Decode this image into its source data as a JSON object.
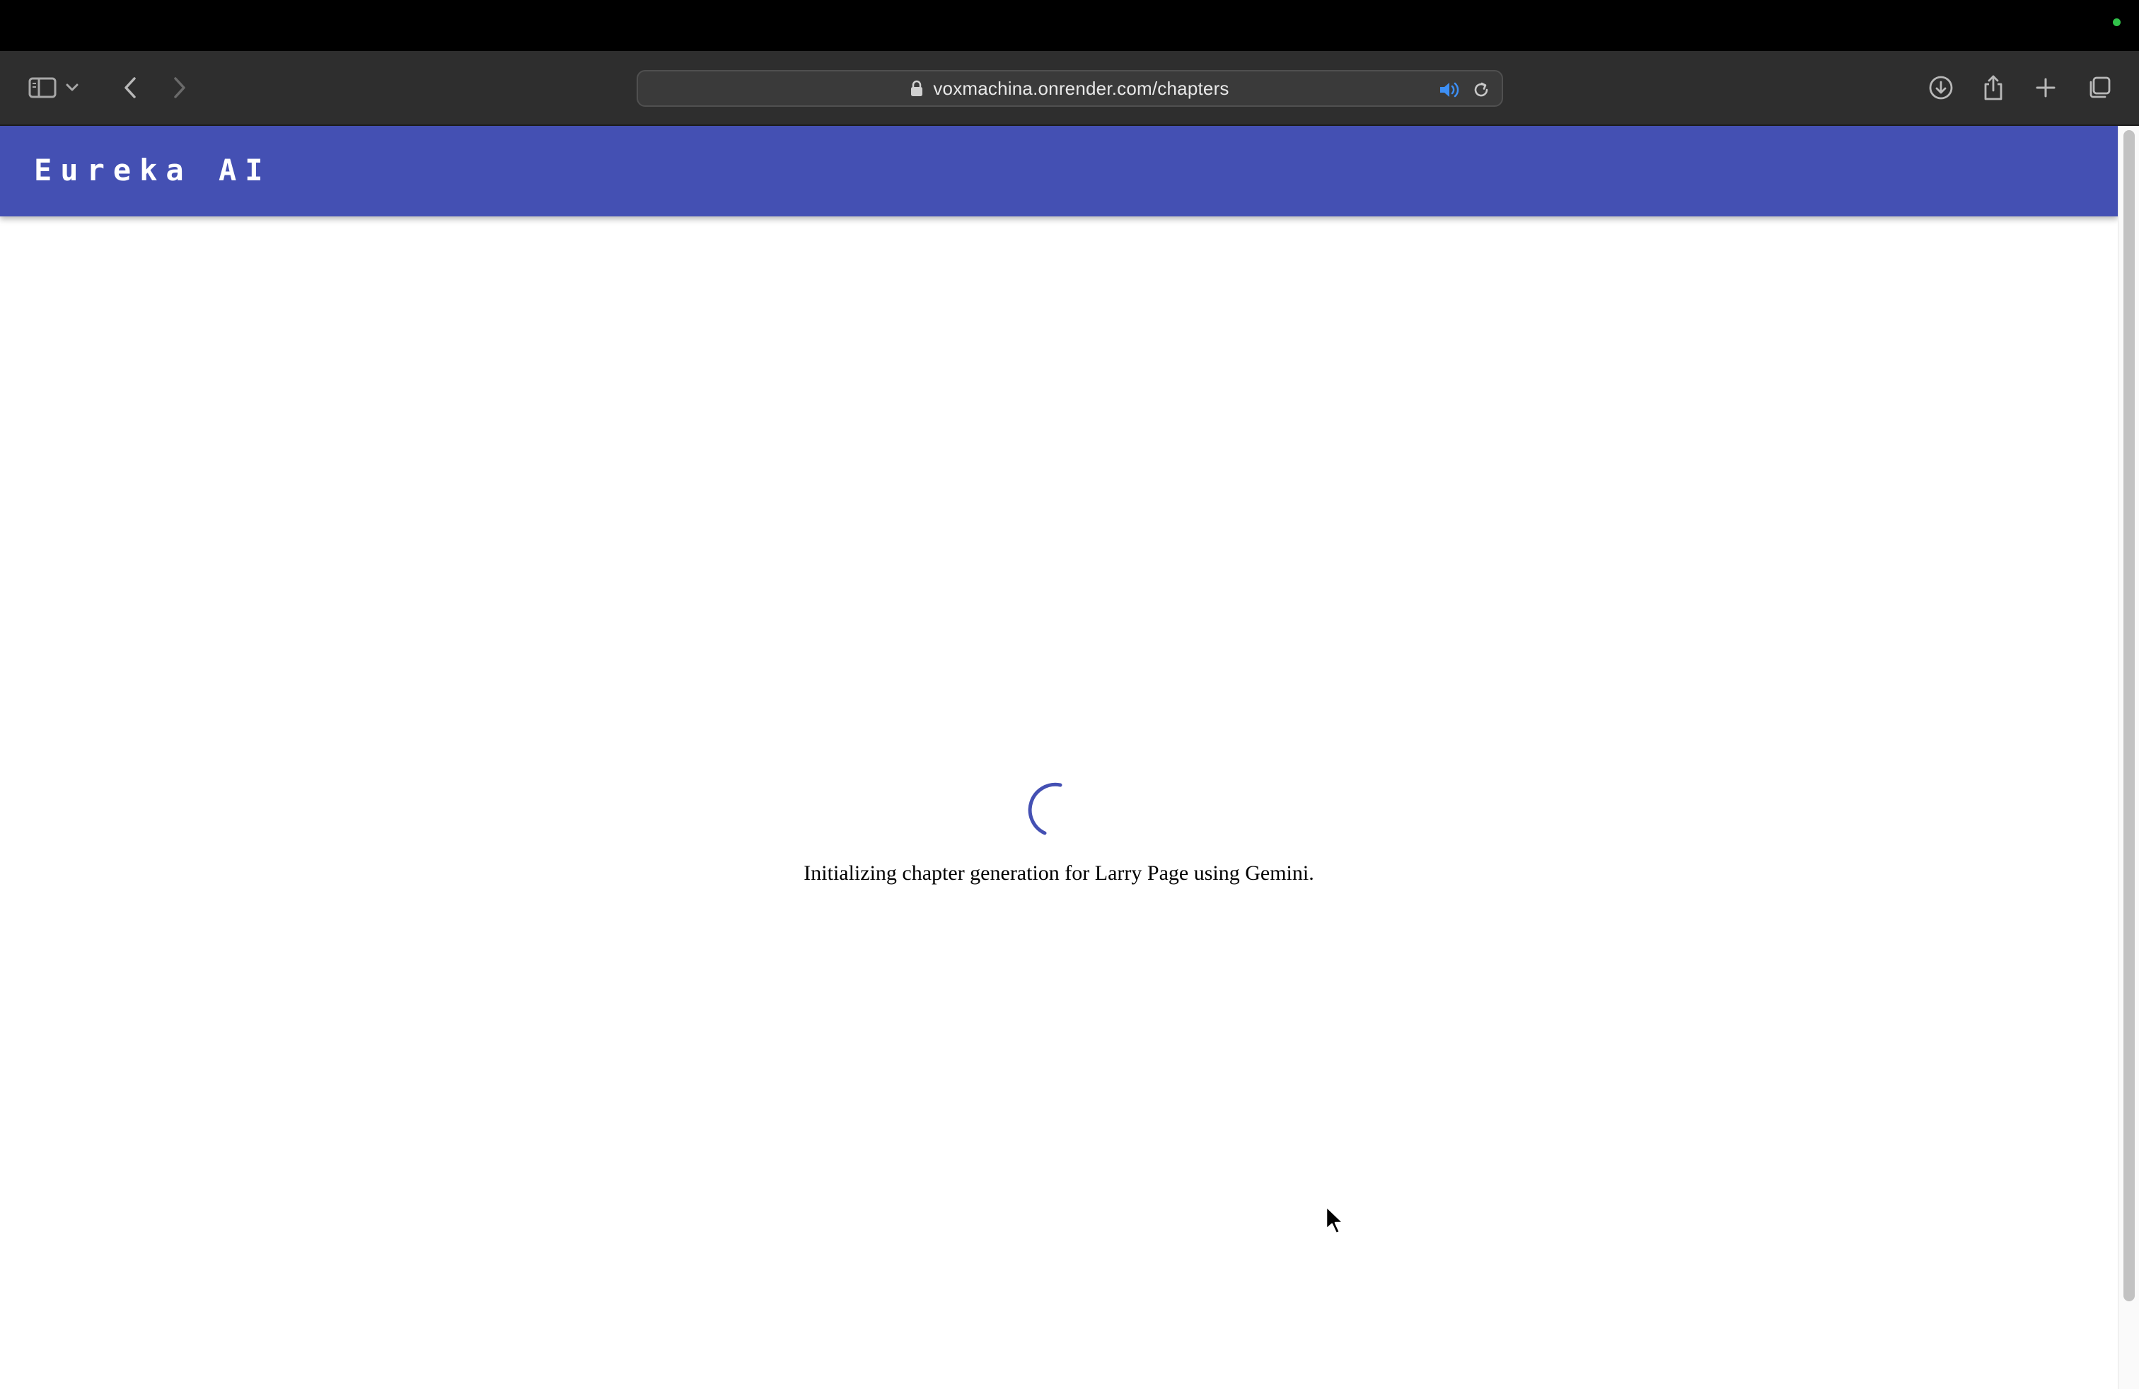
{
  "browser": {
    "address_bar": {
      "url": "voxmachina.onrender.com/chapters"
    },
    "icons": {
      "sidebar": "sidebar-icon",
      "tab_group_menu": "chevron-down-icon",
      "back": "chevron-left-icon",
      "forward": "chevron-right-icon",
      "lock": "lock-icon",
      "audio": "speaker-icon",
      "reload": "reload-icon",
      "downloads": "download-icon",
      "share": "share-icon",
      "new_tab": "plus-icon",
      "tab_overview": "tabs-icon"
    }
  },
  "app": {
    "brand": "Eureka AI",
    "brand_color": "#4450b3"
  },
  "main": {
    "status_text": "Initializing chapter generation for Larry Page using Gemini.",
    "spinner_color": "#4450b3"
  }
}
